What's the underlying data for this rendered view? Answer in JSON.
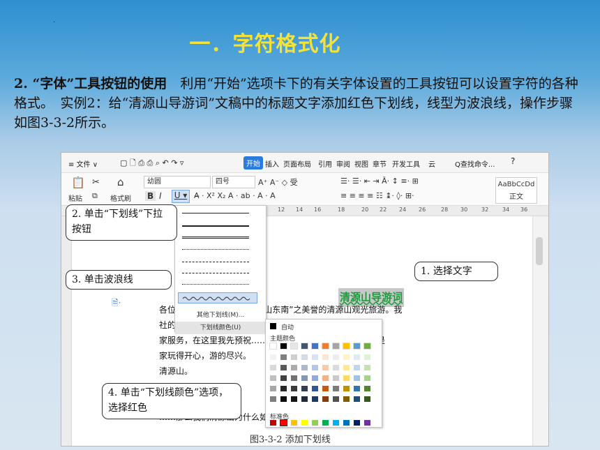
{
  "slide": {
    "dot": ".",
    "title": "一．字符格式化",
    "para_lead": "2. “字体”工具按钮的使用",
    "para_rest": "　利用“开始”选项卡下的有关字体设置的工具按钮可以设置字符的各种格式。　实例2：给“清源山导游词”文稿中的标题文字添加红色下划线，线型为波浪线，操作步骤如图3-3-2所示。"
  },
  "menubar": {
    "file": "≡ 文件 ∨",
    "start": "开始",
    "tabs": [
      "插入",
      "页面布局",
      "引用",
      "审阅",
      "视图",
      "章节",
      "开发工具",
      "云"
    ],
    "search": "Q查找命令...",
    "help": "?"
  },
  "ribbon": {
    "paste": "粘贴",
    "format_painter": "格式刷",
    "font_name": "幼圆",
    "font_size": "四号",
    "style_preview": "AaBbCcDd",
    "style_name": "正文"
  },
  "ruler_ticks": [
    "12",
    "14",
    "16",
    "18",
    "20",
    "22",
    "24",
    "26",
    "28",
    "30",
    "32",
    "34",
    "36"
  ],
  "doc": {
    "title": "清源山导游词",
    "lines": [
      "各位……欢迎大家来到有“香山东南”之美誉的清源山观光旅游。我",
      "社的……号码是：1354786392X。很高兴今",
      "家服务，在这里我先预祝……的限制，我们今天参观的景点是",
      "家玩得开心，游的尽兴。",
      "清源山。",
      "",
      "",
      "……那么我们清源山为什么如此出名吗？"
    ]
  },
  "underline_menu": {
    "more": "其他下划线(M)...",
    "color": "下划线颜色(U)"
  },
  "color_panel": {
    "auto": "自动",
    "theme": "主题颜色",
    "standard": "标准色"
  },
  "callouts": {
    "c1": "1. 选择文字",
    "c2": "2. 单击“下划线”下拉按钮",
    "c3": "3. 单击波浪线",
    "c4": "4. 单击“下划线颜色”选项，选择红色"
  },
  "caption": "图3-3-2 添加下划线",
  "colors": {
    "title": "#f3e23a",
    "doc_title": "#1a9c3a",
    "accent": "#2b7ddd"
  }
}
